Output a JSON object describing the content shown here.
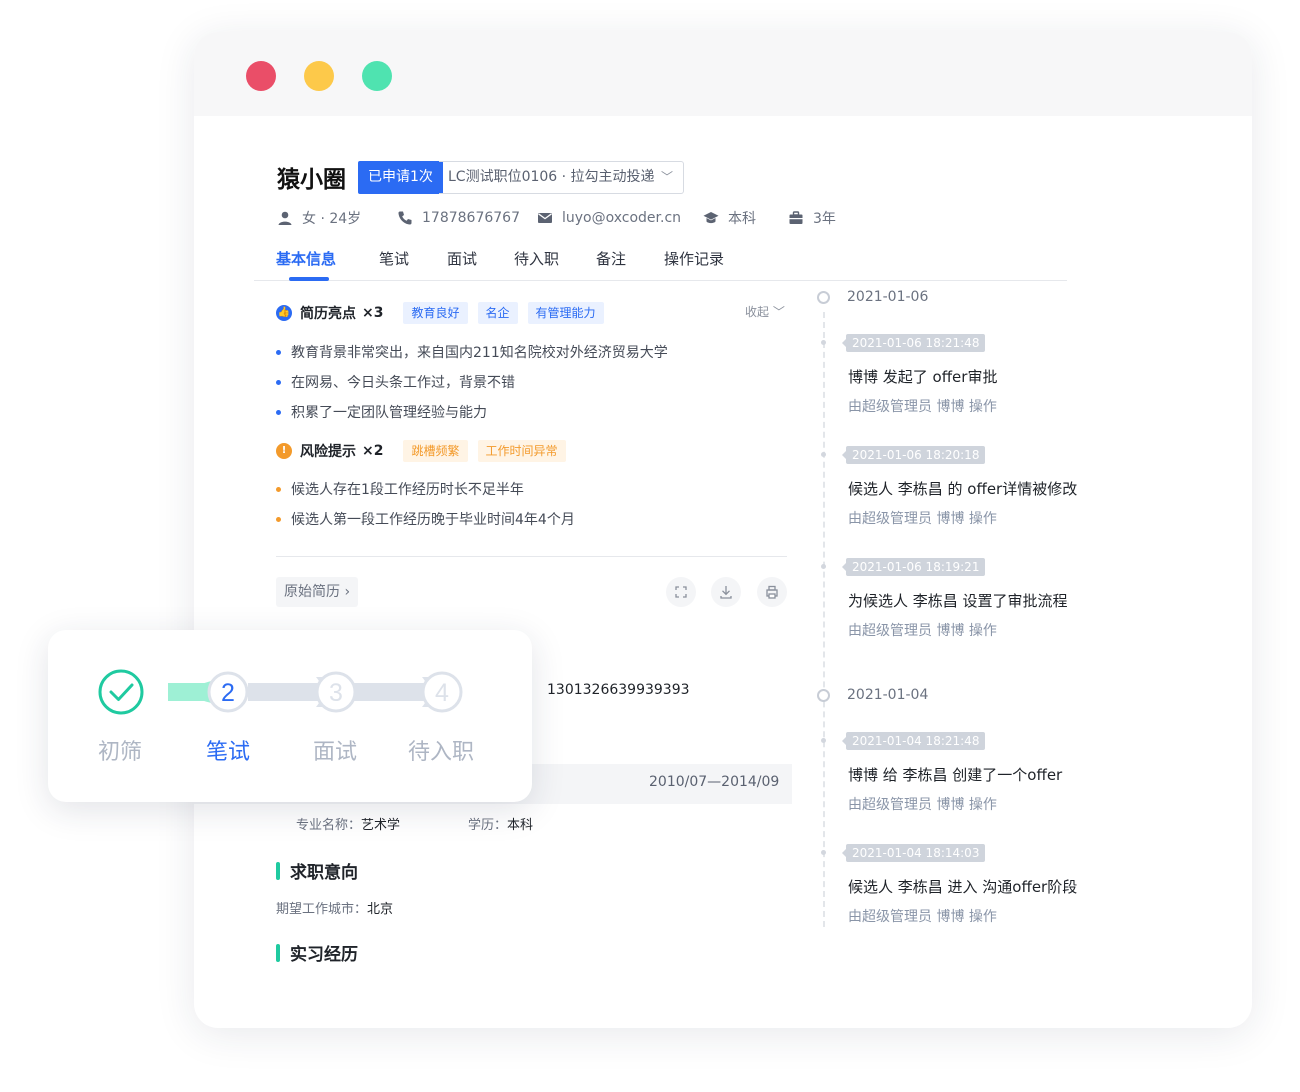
{
  "candidate": {
    "name": "猿小圈",
    "applied_badge": "已申请1次",
    "job_select": "LC测试职位0106 · 拉勾主动投递",
    "gender_age": "女 · 24岁",
    "phone": "17878676767",
    "email": "luyo@oxcoder.cn",
    "education": "本科",
    "experience": "3年"
  },
  "tabs": [
    "基本信息",
    "笔试",
    "面试",
    "待入职",
    "备注",
    "操作记录"
  ],
  "highlights": {
    "title": "简历亮点",
    "count": "×3",
    "tags": [
      "教育良好",
      "名企",
      "有管理能力"
    ],
    "collapse_label": "收起",
    "items": [
      "教育背景非常突出，来自国内211知名院校对外经济贸易大学",
      "在网易、今日头条工作过，背景不错",
      "积累了一定团队管理经验与能力"
    ]
  },
  "risks": {
    "title": "风险提示",
    "count": "×2",
    "tags": [
      "跳槽频繁",
      "工作时间异常"
    ],
    "items": [
      "候选人存在1段工作经历时长不足半年",
      "候选人第一段工作经历晚于毕业时间4年4个月"
    ]
  },
  "resume": {
    "original_label": "原始简历",
    "id_number": "1301326639939393",
    "edu_period": "2010/07—2014/09",
    "major_label": "专业名称：",
    "major_value": "艺术学",
    "degree_label": "学历：",
    "degree_value": "本科",
    "intent_title": "求职意向",
    "city_label": "期望工作城市：",
    "city_value": "北京",
    "intern_title": "实习经历"
  },
  "timeline": [
    {
      "date": "2021-01-06",
      "events": [
        {
          "time": "2021-01-06 18:21:48",
          "text": "博博 发起了 offer审批",
          "sub": "由超级管理员 博博 操作"
        },
        {
          "time": "2021-01-06 18:20:18",
          "text": "候选人 李栋昌 的 offer详情被修改",
          "sub": "由超级管理员 博博 操作"
        },
        {
          "time": "2021-01-06 18:19:21",
          "text": "为候选人 李栋昌 设置了审批流程",
          "sub": "由超级管理员 博博 操作"
        }
      ]
    },
    {
      "date": "2021-01-04",
      "events": [
        {
          "time": "2021-01-04 18:21:48",
          "text": "博博 给 李栋昌 创建了一个offer",
          "sub": "由超级管理员 博博 操作"
        },
        {
          "time": "2021-01-04 18:14:03",
          "text": "候选人 李栋昌 进入 沟通offer阶段",
          "sub": "由超级管理员 博博 操作"
        }
      ]
    }
  ],
  "steps": {
    "labels": [
      "初筛",
      "笔试",
      "面试",
      "待入职"
    ],
    "numbers": [
      "2",
      "3",
      "4"
    ],
    "current": "2",
    "colors": {
      "done": "#1fcaa0",
      "done_track": "#9ef0d5",
      "active": "#2b6bf3",
      "pending": "#dde2ea",
      "label_pending": "#aeb6c4"
    }
  },
  "colors": {
    "accent": "#2b6bf3",
    "green_bar": "#1fcaa0",
    "risk": "#f39a2b"
  },
  "icons": [
    "user-icon",
    "phone-icon",
    "mail-icon",
    "graduation-icon",
    "briefcase-icon",
    "thumb-up-icon",
    "warning-icon",
    "chevron-down-icon",
    "chevron-right-icon",
    "expand-icon",
    "download-icon",
    "print-icon",
    "check-icon"
  ]
}
